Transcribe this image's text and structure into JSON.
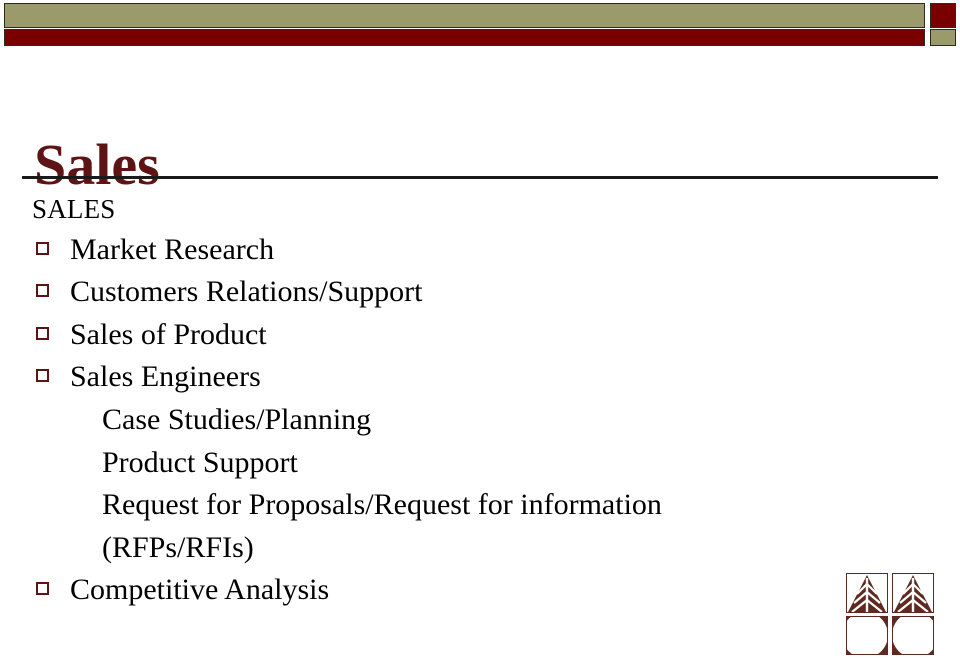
{
  "slide": {
    "title": "Sales",
    "heading": "SALES",
    "items": [
      {
        "bullet": true,
        "text": "Market Research"
      },
      {
        "bullet": true,
        "text": "Customers Relations/Support"
      },
      {
        "bullet": true,
        "text": "Sales of Product"
      },
      {
        "bullet": true,
        "text": "Sales Engineers"
      },
      {
        "bullet": false,
        "text": "Case Studies/Planning"
      },
      {
        "bullet": false,
        "text": "Product Support"
      },
      {
        "bullet": false,
        "text": "Request for Proposals/Request for information (RFPs/RFIs)"
      },
      {
        "bullet": true,
        "text": "Competitive Analysis"
      }
    ]
  },
  "decor": {
    "olive": "#9a9a6a",
    "maroon": "#7a0000",
    "title_color": "#5e1414",
    "rule_color": "#1a1a1a",
    "bullet_color": "#5e1414",
    "logo_color": "#5e2a20",
    "bar_top_name": "header-olive-bar",
    "bar_bottom_name": "header-maroon-bar",
    "corner_top_name": "header-corner-maroon-square",
    "corner_bottom_name": "header-corner-olive-square",
    "logo_name": "company-logo"
  }
}
